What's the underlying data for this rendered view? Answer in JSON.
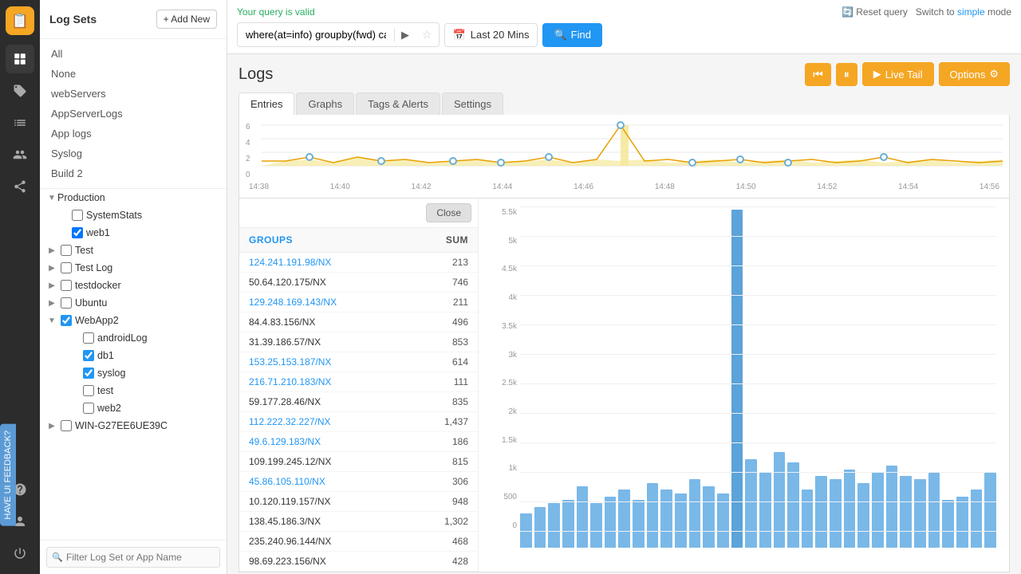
{
  "app": {
    "title": "Log Sets",
    "add_new_label": "+ Add New"
  },
  "header": {
    "query_valid_text": "Your query is valid",
    "query_value": "where(at=info) groupby(fwd) calculate(sum:service)",
    "date_range": "Last 20 Mins",
    "find_label": "Find",
    "reset_label": "Reset query",
    "switch_label": "Switch to",
    "simple_label": "simple",
    "mode_label": "mode"
  },
  "logs": {
    "title": "Logs",
    "tabs": [
      "Entries",
      "Graphs",
      "Tags & Alerts",
      "Settings"
    ],
    "active_tab": "Entries",
    "live_tail_label": "Live Tail",
    "options_label": "Options"
  },
  "sidebar": {
    "nav": [
      "All",
      "None",
      "webServers",
      "AppServerLogs",
      "App logs",
      "Syslog",
      "Build 2"
    ],
    "production_label": "Production",
    "search_placeholder": "Filter Log Set or App Name",
    "tree_items": [
      {
        "label": "SystemStats",
        "indent": 1,
        "checked": false,
        "expandable": false
      },
      {
        "label": "web1",
        "indent": 1,
        "checked": true,
        "expandable": false
      },
      {
        "label": "Test",
        "indent": 0,
        "checked": false,
        "expandable": true
      },
      {
        "label": "Test Log",
        "indent": 0,
        "checked": false,
        "expandable": true
      },
      {
        "label": "testdocker",
        "indent": 0,
        "checked": false,
        "expandable": true
      },
      {
        "label": "Ubuntu",
        "indent": 0,
        "checked": false,
        "expandable": true
      },
      {
        "label": "WebApp2",
        "indent": 0,
        "checked": true,
        "expandable": true,
        "expanded": true
      },
      {
        "label": "androidLog",
        "indent": 1,
        "checked": false,
        "expandable": false
      },
      {
        "label": "db1",
        "indent": 1,
        "checked": true,
        "expandable": false
      },
      {
        "label": "syslog",
        "indent": 1,
        "checked": true,
        "expandable": false
      },
      {
        "label": "test",
        "indent": 1,
        "checked": false,
        "expandable": false
      },
      {
        "label": "web2",
        "indent": 1,
        "checked": false,
        "expandable": false
      },
      {
        "label": "WIN-G27EE6UE39C",
        "indent": 0,
        "checked": false,
        "expandable": true
      }
    ]
  },
  "chart": {
    "y_labels": [
      "6",
      "4",
      "2",
      "0"
    ],
    "x_labels": [
      "14:38",
      "14:40",
      "14:42",
      "14:44",
      "14:46",
      "14:48",
      "14:50",
      "14:52",
      "14:54",
      "14:56"
    ]
  },
  "table": {
    "col_groups": "GROUPS",
    "col_sum": "SUM",
    "close_label": "Close",
    "rows": [
      {
        "group": "124.241.191.98/NX",
        "sum": "213",
        "link": true
      },
      {
        "group": "50.64.120.175/NX",
        "sum": "746",
        "link": false
      },
      {
        "group": "129.248.169.143/NX",
        "sum": "211",
        "link": true
      },
      {
        "group": "84.4.83.156/NX",
        "sum": "496",
        "link": false
      },
      {
        "group": "31.39.186.57/NX",
        "sum": "853",
        "link": false
      },
      {
        "group": "153.25.153.187/NX",
        "sum": "614",
        "link": true
      },
      {
        "group": "216.71.210.183/NX",
        "sum": "111",
        "link": true
      },
      {
        "group": "59.177.28.46/NX",
        "sum": "835",
        "link": false
      },
      {
        "group": "112.222.32.227/NX",
        "sum": "1,437",
        "link": true
      },
      {
        "group": "49.6.129.183/NX",
        "sum": "186",
        "link": true
      },
      {
        "group": "109.199.245.12/NX",
        "sum": "815",
        "link": false
      },
      {
        "group": "45.86.105.110/NX",
        "sum": "306",
        "link": true
      },
      {
        "group": "10.120.119.157/NX",
        "sum": "948",
        "link": false
      },
      {
        "group": "138.45.186.3/NX",
        "sum": "1,302",
        "link": false
      },
      {
        "group": "235.240.96.144/NX",
        "sum": "468",
        "link": false
      },
      {
        "group": "98.69.223.156/NX",
        "sum": "428",
        "link": false
      }
    ]
  },
  "bar_chart": {
    "y_labels": [
      "5.5k",
      "5k",
      "4.5k",
      "4k",
      "3.5k",
      "3k",
      "2.5k",
      "2k",
      "1.5k",
      "1k",
      "500",
      "0"
    ],
    "bars": [
      0.1,
      0.12,
      0.13,
      0.14,
      0.18,
      0.13,
      0.15,
      0.17,
      0.14,
      0.19,
      0.17,
      0.16,
      0.2,
      0.18,
      0.16,
      0.99,
      0.26,
      0.22,
      0.28,
      0.25,
      0.17,
      0.21,
      0.2,
      0.23,
      0.19,
      0.22,
      0.24,
      0.21,
      0.2,
      0.22,
      0.14,
      0.15,
      0.17,
      0.22
    ]
  },
  "icons": {
    "logo": "📋",
    "logs": "📄",
    "tags": "🏷",
    "charts": "📊",
    "connections": "🔗",
    "share": "⬆",
    "help": "?",
    "user": "👤",
    "power": "⏻",
    "search": "🔍",
    "calendar": "📅",
    "gear": "⚙",
    "play": "▶",
    "pause": "⏸",
    "rewind": "⏮",
    "arrow_right": "▶",
    "star": "☆"
  }
}
